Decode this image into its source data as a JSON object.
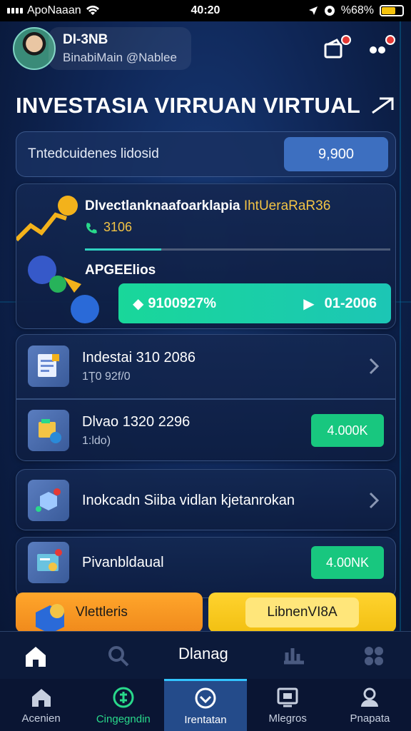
{
  "status_bar": {
    "carrier": "ApoNaaan",
    "time": "40:20",
    "battery": "%68%",
    "battery_level": 0.68
  },
  "header": {
    "user_name": "DI-3NB",
    "user_handle": "BinabiMain @Nablee",
    "icons": [
      "wallet-icon",
      "more-icon"
    ]
  },
  "page": {
    "title": "INVESTASIA VIRRUAN VIRTUAL"
  },
  "search": {
    "text": "Tntedcuidenes lidosid",
    "button_value": "9,900"
  },
  "hero": {
    "title_main": "Dlvectlanknaafoarklapia",
    "title_accent": "IhtUeraRaR36",
    "phone_value": "3106",
    "progress_fraction": 0.25,
    "label": "APGEElios",
    "bar_left": "9100927%",
    "bar_right": "01-2006"
  },
  "list": [
    {
      "title": "Indestai 310 2086",
      "subtitle": "1Ţ0 92f/0",
      "action": "chevron"
    },
    {
      "title": "Dlvao 1320 2296",
      "subtitle": "1:ldo)",
      "action_label": "4.000K"
    },
    {
      "title": "Inokcadn Siiba vidlan kjetanrokan",
      "action": "chevron"
    },
    {
      "title": "Pivanbldaual",
      "action_label": "4.00NK"
    }
  ],
  "promos": {
    "left": "Vlettleris",
    "right": "LibnenVI8A"
  },
  "sub_nav": {
    "center_label": "Dlanag"
  },
  "tabs": [
    {
      "label": "Acenien",
      "icon": "home-icon"
    },
    {
      "label": "Cingegndin",
      "icon": "coin-icon"
    },
    {
      "label": "Irentatan",
      "icon": "shield-icon"
    },
    {
      "label": "Mlegros",
      "icon": "messages-icon"
    },
    {
      "label": "Pnapata",
      "icon": "profile-icon"
    }
  ],
  "colors": {
    "accent_green": "#18c77f",
    "accent_blue": "#3d6fc0",
    "accent_yellow": "#f3c445",
    "tab_active": "#244b8a"
  }
}
